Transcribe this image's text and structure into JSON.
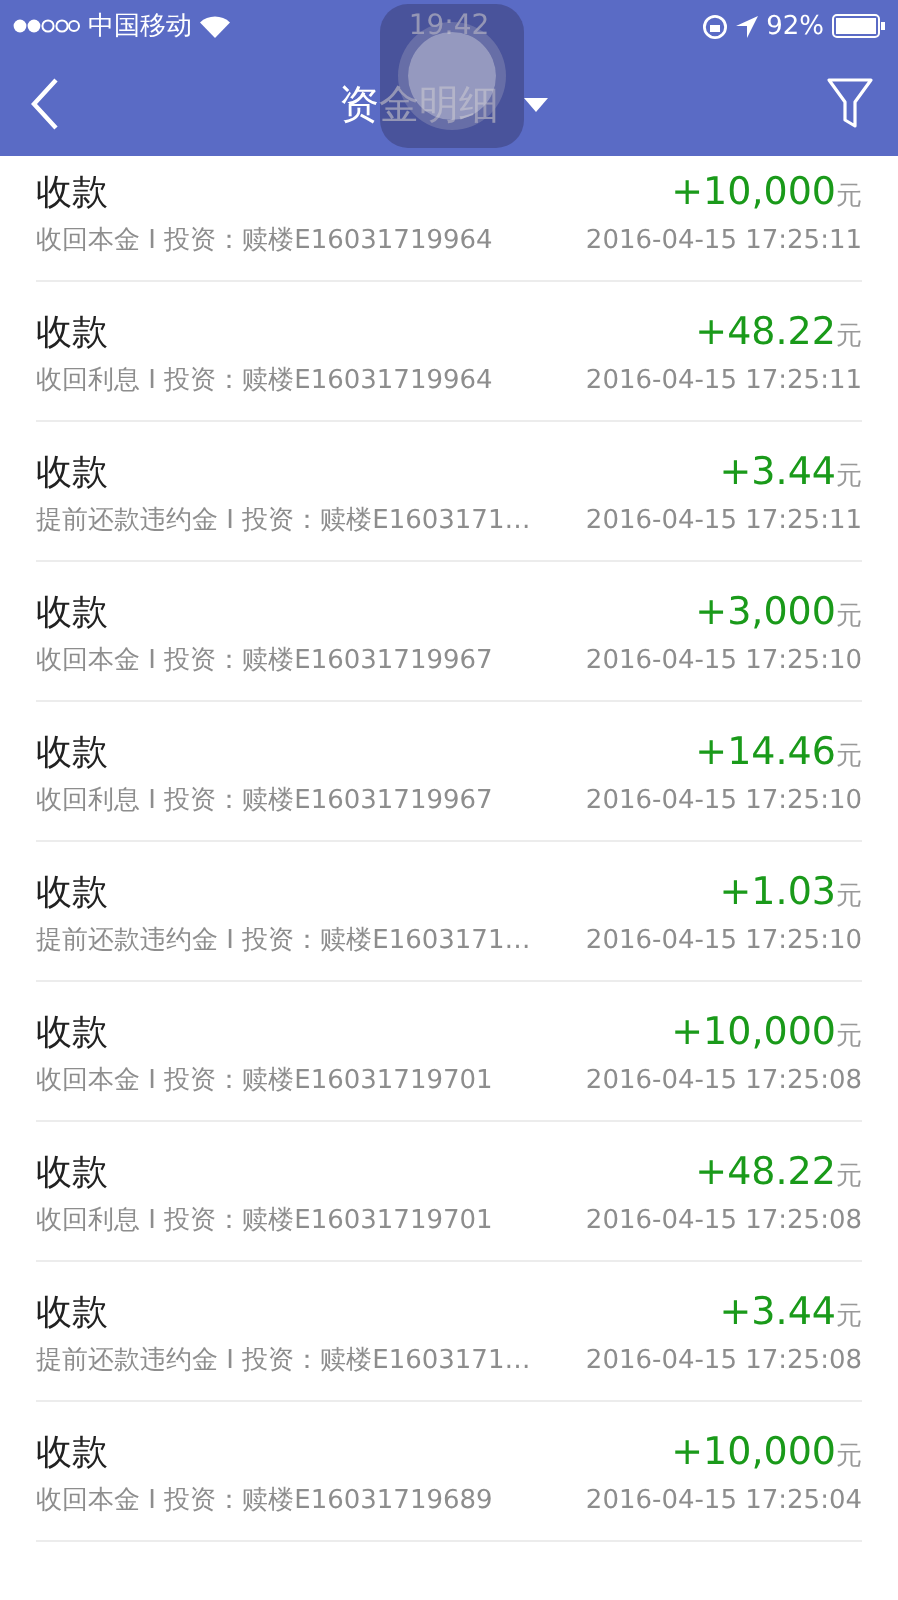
{
  "status_bar": {
    "carrier": "中国移动",
    "time": "19:42",
    "battery": "92%"
  },
  "nav": {
    "title": "资金明细"
  },
  "rows": [
    {
      "title": "收款",
      "note": "收回本金 I 投资：赎楼E16031719964",
      "amount": "+10,000",
      "unit": "元",
      "time": "2016-04-15 17:25:11"
    },
    {
      "title": "收款",
      "note": "收回利息 I 投资：赎楼E16031719964",
      "amount": "+48.22",
      "unit": "元",
      "time": "2016-04-15 17:25:11"
    },
    {
      "title": "收款",
      "note": "提前还款违约金 I 投资：赎楼E1603171…",
      "amount": "+3.44",
      "unit": "元",
      "time": "2016-04-15 17:25:11"
    },
    {
      "title": "收款",
      "note": "收回本金 I 投资：赎楼E16031719967",
      "amount": "+3,000",
      "unit": "元",
      "time": "2016-04-15 17:25:10"
    },
    {
      "title": "收款",
      "note": "收回利息 I 投资：赎楼E16031719967",
      "amount": "+14.46",
      "unit": "元",
      "time": "2016-04-15 17:25:10"
    },
    {
      "title": "收款",
      "note": "提前还款违约金 I 投资：赎楼E1603171…",
      "amount": "+1.03",
      "unit": "元",
      "time": "2016-04-15 17:25:10"
    },
    {
      "title": "收款",
      "note": "收回本金 I 投资：赎楼E16031719701",
      "amount": "+10,000",
      "unit": "元",
      "time": "2016-04-15 17:25:08"
    },
    {
      "title": "收款",
      "note": "收回利息 I 投资：赎楼E16031719701",
      "amount": "+48.22",
      "unit": "元",
      "time": "2016-04-15 17:25:08"
    },
    {
      "title": "收款",
      "note": "提前还款违约金 I 投资：赎楼E1603171…",
      "amount": "+3.44",
      "unit": "元",
      "time": "2016-04-15 17:25:08"
    },
    {
      "title": "收款",
      "note": "收回本金 I 投资：赎楼E16031719689",
      "amount": "+10,000",
      "unit": "元",
      "time": "2016-04-15 17:25:04"
    }
  ]
}
